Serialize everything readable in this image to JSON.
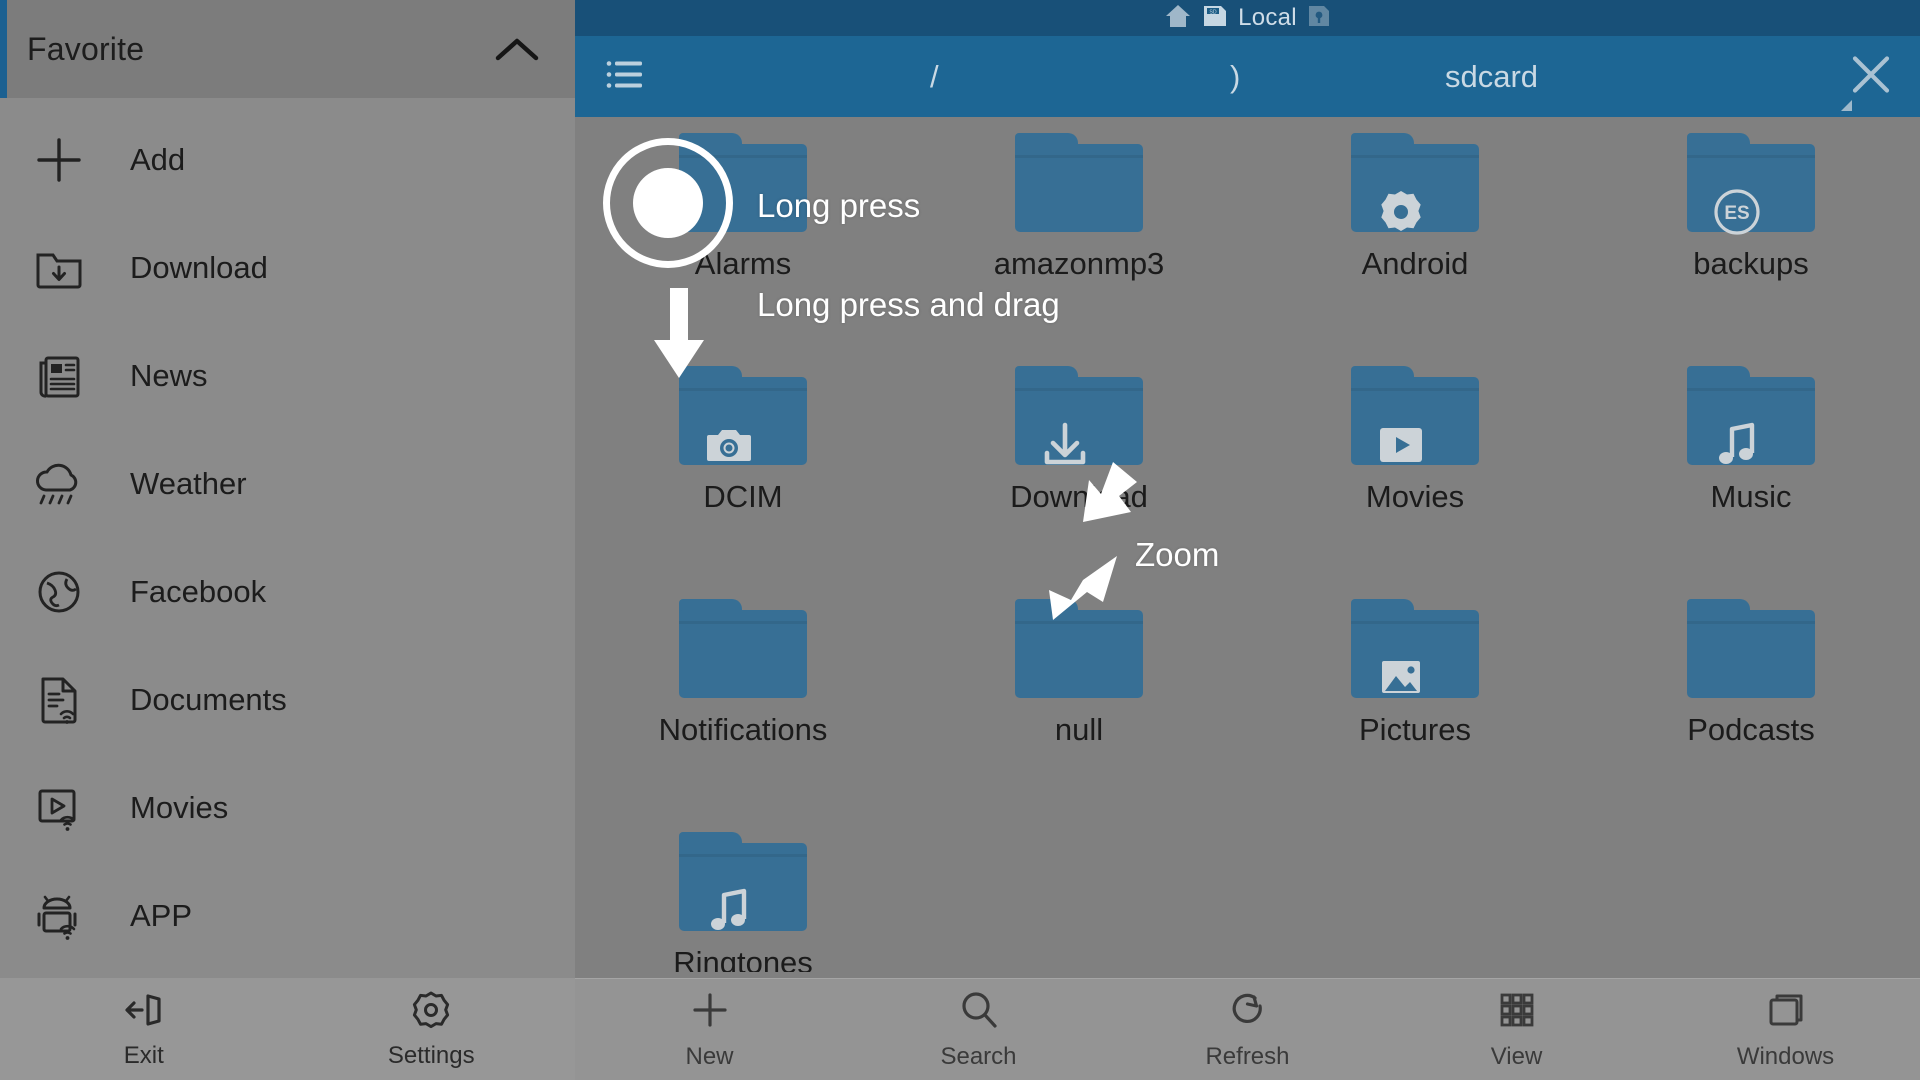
{
  "sidebar": {
    "header": {
      "title": "Favorite",
      "collapse_icon": "chevron-up-icon"
    },
    "items": [
      {
        "label": "Add",
        "icon": "plus-icon"
      },
      {
        "label": "Download",
        "icon": "folder-download-icon"
      },
      {
        "label": "News",
        "icon": "newspaper-icon"
      },
      {
        "label": "Weather",
        "icon": "rain-cloud-icon"
      },
      {
        "label": "Facebook",
        "icon": "globe-icon"
      },
      {
        "label": "Documents",
        "icon": "document-wifi-icon"
      },
      {
        "label": "Movies",
        "icon": "video-wifi-icon"
      },
      {
        "label": "APP",
        "icon": "android-wifi-icon"
      }
    ],
    "bottom_buttons": [
      {
        "label": "Exit",
        "icon": "exit-icon"
      },
      {
        "label": "Settings",
        "icon": "gear-icon"
      }
    ]
  },
  "topbar": {
    "home_icon": "home-icon",
    "storage_icon": "sdcard-icon",
    "location_label": "Local",
    "secondary_icon": "sdcard-locked-icon"
  },
  "pathbar": {
    "menu_icon": "hamburger-menu-icon",
    "crumbs": [
      {
        "label": "/"
      },
      {
        "label": ")"
      },
      {
        "label": "sdcard"
      }
    ],
    "close_icon": "close-icon",
    "resize_icon": "resize-corner-icon"
  },
  "grid": {
    "rows": [
      [
        {
          "name": "Alarms",
          "badge": "none"
        },
        {
          "name": "amazonmp3",
          "badge": "none"
        },
        {
          "name": "Android",
          "badge": "gear-icon"
        },
        {
          "name": "backups",
          "badge": "es-logo-icon"
        }
      ],
      [
        {
          "name": "DCIM",
          "badge": "camera-icon"
        },
        {
          "name": "Download",
          "badge": "download-icon"
        },
        {
          "name": "Movies",
          "badge": "play-icon"
        },
        {
          "name": "Music",
          "badge": "music-note-icon"
        }
      ],
      [
        {
          "name": "Notifications",
          "badge": "none"
        },
        {
          "name": "null",
          "badge": "none"
        },
        {
          "name": "Pictures",
          "badge": "image-icon"
        },
        {
          "name": "Podcasts",
          "badge": "none"
        }
      ],
      [
        {
          "name": "Ringtones",
          "badge": "music-note-icon"
        },
        {
          "name": "",
          "badge": "none"
        },
        {
          "name": "",
          "badge": "none"
        },
        {
          "name": "",
          "badge": "none"
        }
      ]
    ]
  },
  "bottombar": {
    "buttons": [
      {
        "label": "New",
        "icon": "plus-icon"
      },
      {
        "label": "Search",
        "icon": "search-icon"
      },
      {
        "label": "Refresh",
        "icon": "refresh-icon"
      },
      {
        "label": "View",
        "icon": "grid-view-icon"
      },
      {
        "label": "Windows",
        "icon": "windows-icon"
      }
    ]
  },
  "gestures": {
    "long_press": "Long press",
    "long_press_and_drag": "Long press and drag",
    "zoom": "Zoom"
  },
  "colors": {
    "header_blue_dark": "#185078",
    "header_blue": "#1d6694",
    "folder_blue": "#376f95",
    "accent_stripe": "#1b6091",
    "sidebar_bg": "#8b8b8b",
    "page_bg": "#808080",
    "text_dark": "#1b1b1b",
    "text_light": "#c9d9e4"
  }
}
